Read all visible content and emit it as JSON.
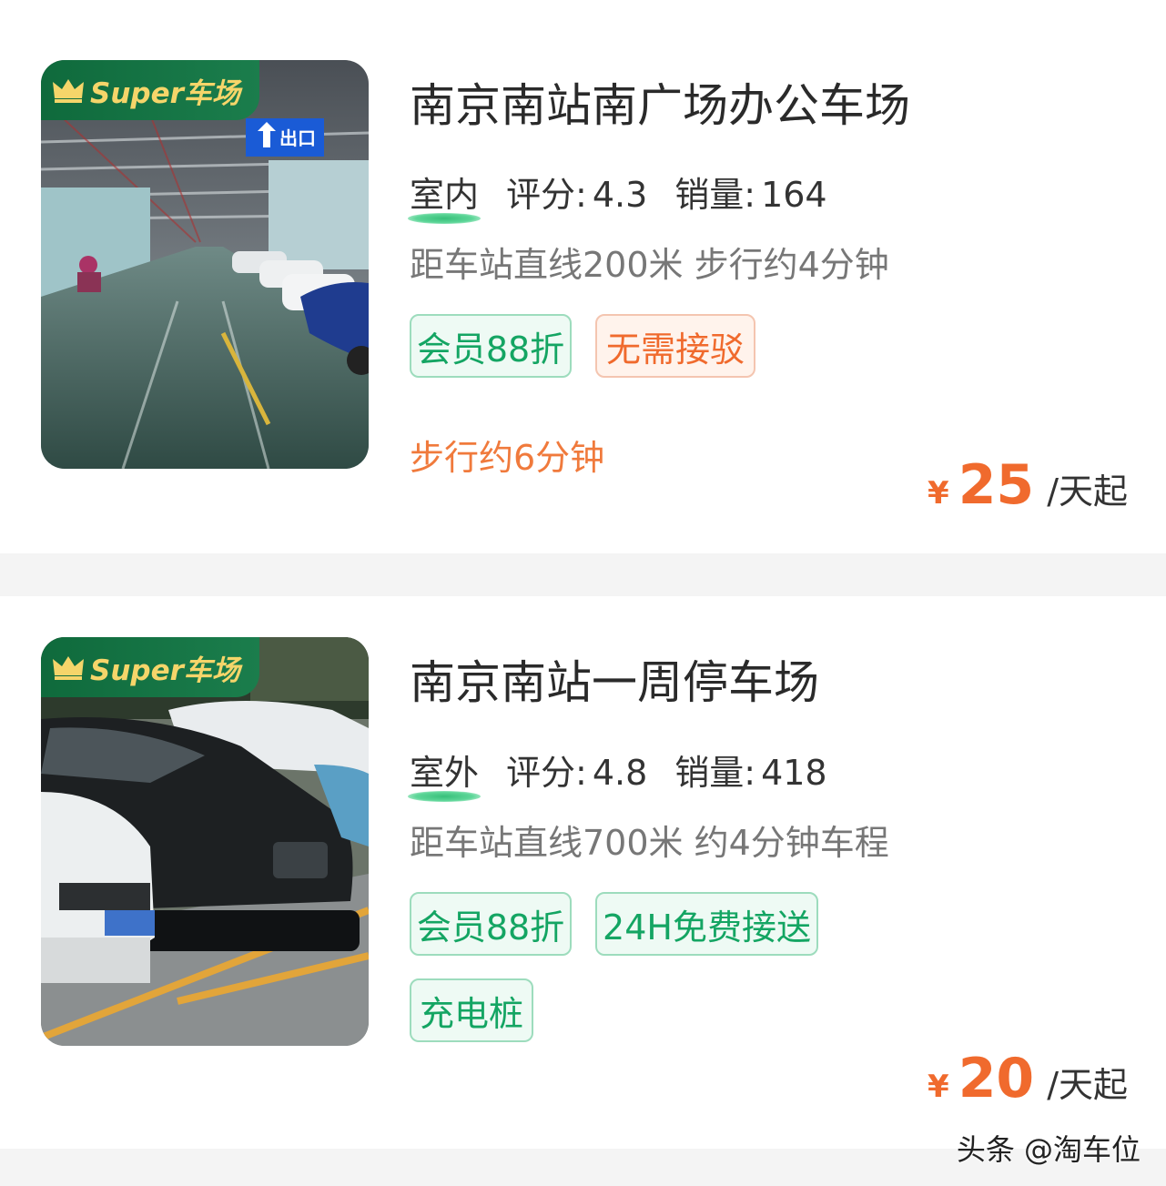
{
  "badge_text": "Super车场",
  "colors": {
    "accent_green": "#14a563",
    "accent_orange": "#f06a2d",
    "badge_green": "#0f6a3c"
  },
  "listings": [
    {
      "title": "南京南站南广场办公车场",
      "type": "室内",
      "rating_label": "评分:",
      "rating": "4.3",
      "sales_label": "销量:",
      "sales": "164",
      "distance": "距车站直线200米 步行约4分钟",
      "tags": [
        {
          "text": "会员88折",
          "style": "green"
        },
        {
          "text": "无需接驳",
          "style": "orange"
        }
      ],
      "walk_note": "步行约6分钟",
      "currency": "¥",
      "price": "25",
      "price_unit": "/天起",
      "image_icon": "indoor-parking-garage-photo",
      "exit_sign": "出口"
    },
    {
      "title": "南京南站一周停车场",
      "type": "室外",
      "rating_label": "评分:",
      "rating": "4.8",
      "sales_label": "销量:",
      "sales": "418",
      "distance": "距车站直线700米 约4分钟车程",
      "tags": [
        {
          "text": "会员88折",
          "style": "green"
        },
        {
          "text": "24H免费接送",
          "style": "green"
        },
        {
          "text": "充电桩",
          "style": "green"
        }
      ],
      "currency": "¥",
      "price": "20",
      "price_unit": "/天起",
      "image_icon": "outdoor-parking-lot-photo"
    }
  ],
  "watermark": "头条 @淘车位"
}
